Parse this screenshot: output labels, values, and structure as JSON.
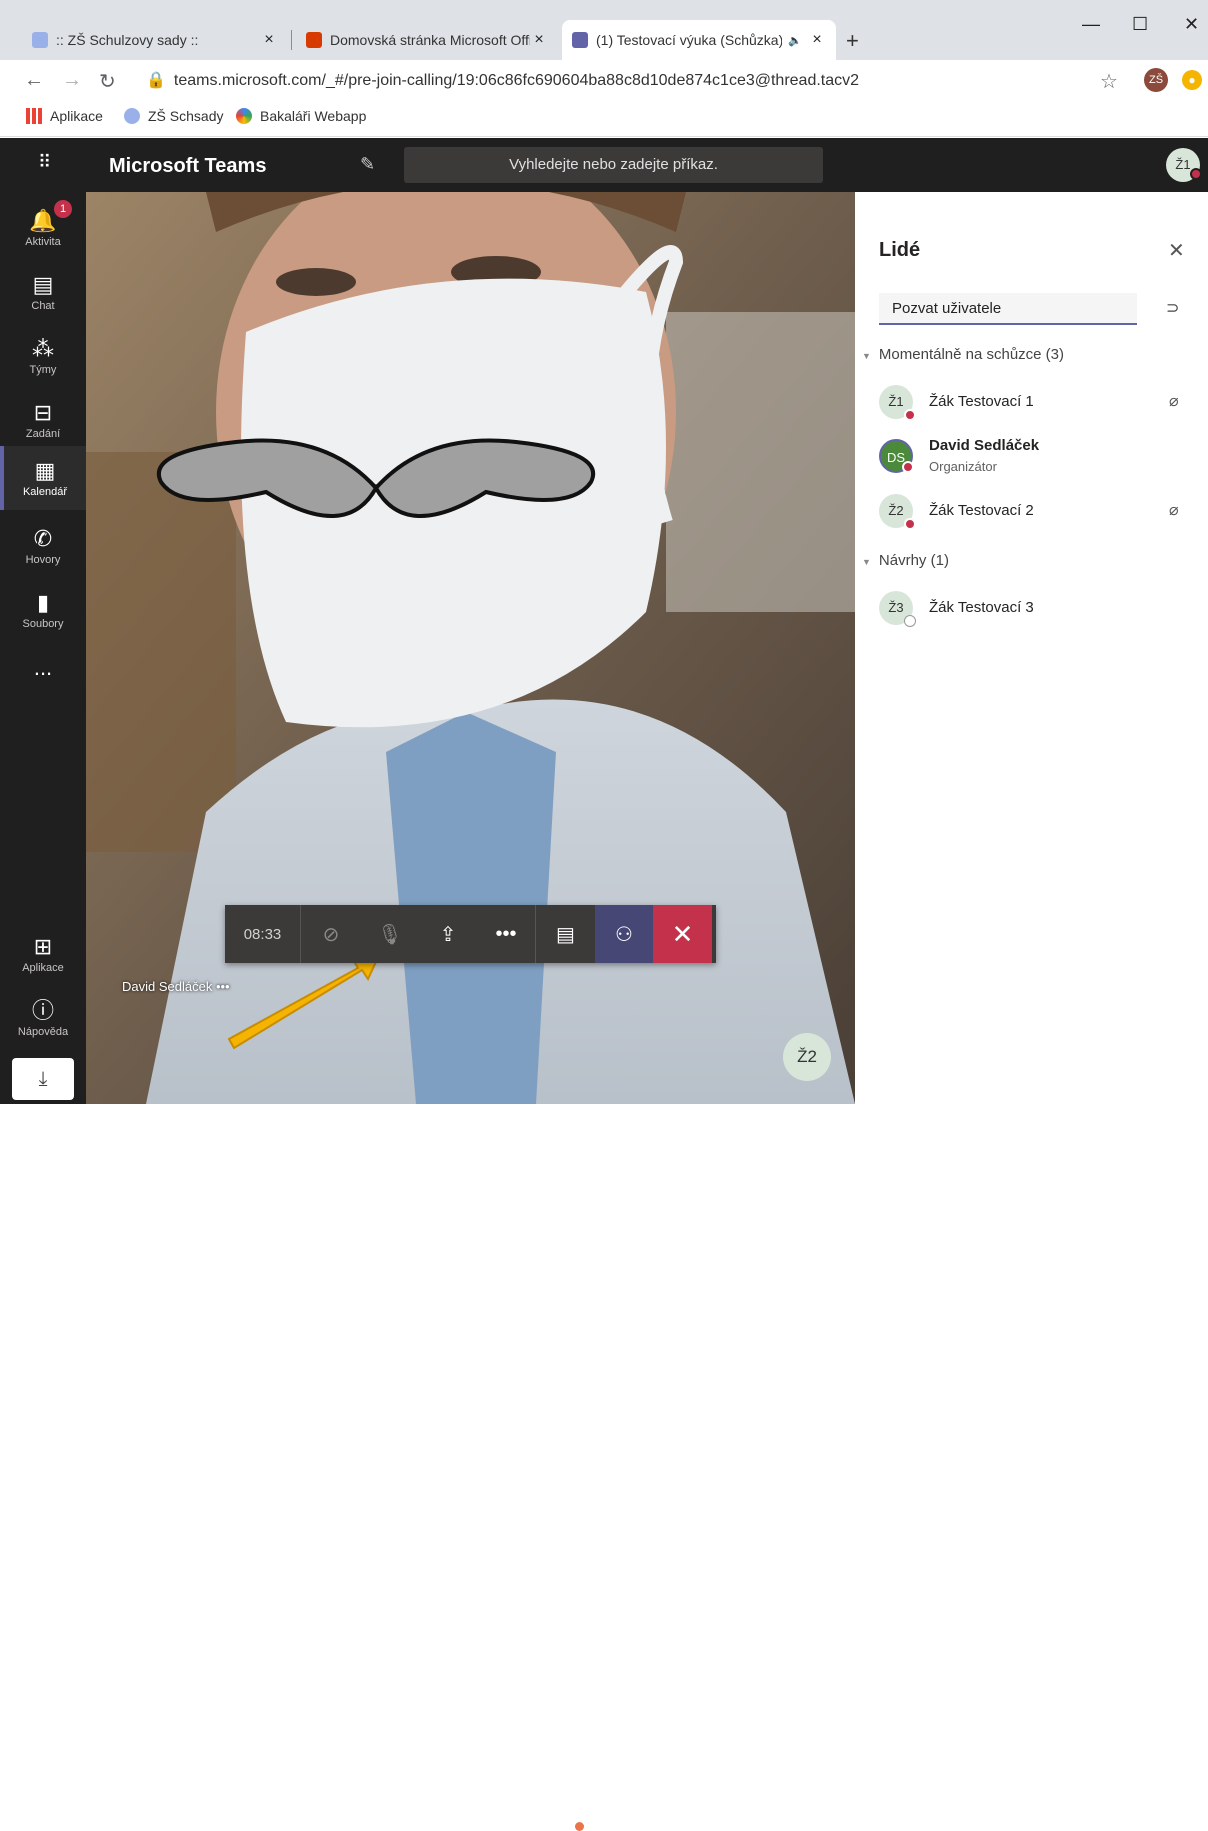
{
  "browser": {
    "tabs": [
      {
        "title": "ZŠ Schulzovy sady",
        "prefix": "::",
        "suffix": "::",
        "close": "×"
      },
      {
        "title": "Domovská stránka Microsoft Offi",
        "close": "×"
      },
      {
        "title": "(1) Testovací výuka (Schůzka)",
        "close": "×",
        "audio": "🔈"
      }
    ],
    "new_tab": "+",
    "window": {
      "minimize": "—",
      "maximize": "☐",
      "close": "✕"
    },
    "nav": {
      "back": "←",
      "forward": "→",
      "reload": "↻"
    },
    "url": "teams.microsoft.com/_#/pre-join-calling/19:06c86fc690604ba88c8d10de874c1ce3@thread.tacv2",
    "profile_initials": "ZŠ",
    "bookmarks": [
      {
        "label": "Aplikace",
        "icon": "apps-grid-icon"
      },
      {
        "label": "ZŠ Schsady",
        "icon": "school-icon"
      },
      {
        "label": "Bakaláři Webapp",
        "icon": "bakalari-icon"
      }
    ]
  },
  "teams": {
    "brand": "Microsoft Teams",
    "search_placeholder": "Vyhledejte nebo zadejte příkaz.",
    "me_initials": "Ž1",
    "rail": [
      {
        "label": "Aktivita",
        "icon": "bell-icon",
        "badge": "1"
      },
      {
        "label": "Chat",
        "icon": "chat-icon"
      },
      {
        "label": "Týmy",
        "icon": "teams-icon"
      },
      {
        "label": "Zadání",
        "icon": "backpack-icon"
      },
      {
        "label": "Kalendář",
        "icon": "calendar-icon",
        "active": true
      },
      {
        "label": "Hovory",
        "icon": "phone-icon"
      },
      {
        "label": "Soubory",
        "icon": "file-icon"
      },
      {
        "label": "...",
        "icon": "more-icon"
      }
    ],
    "rail_bottom": [
      {
        "label": "Aplikace",
        "icon": "apps-icon"
      },
      {
        "label": "Nápověda",
        "icon": "help-icon"
      }
    ]
  },
  "call": {
    "timer": "08:33",
    "speaker_name": "David Sedláček",
    "speaker_more": "•••",
    "tile_initials": "Ž2"
  },
  "people": {
    "title": "Lidé",
    "invite_placeholder": "Pozvat uživatele",
    "current_section": "Momentálně na schůzce (3)",
    "suggest_section": "Návrhy (1)",
    "participants": [
      {
        "initials": "Ž1",
        "name": "Žák Testovací 1",
        "muted": true
      },
      {
        "initials": "DS",
        "name": "David Sedláček",
        "role": "Organizátor"
      },
      {
        "initials": "Ž2",
        "name": "Žák Testovací 2",
        "muted": true
      }
    ],
    "suggestions": [
      {
        "initials": "Ž3",
        "name": "Žák Testovací 3"
      }
    ]
  },
  "colors": {
    "accent": "#6264a7",
    "leave": "#c4314b",
    "arrow": "#f4b400"
  }
}
